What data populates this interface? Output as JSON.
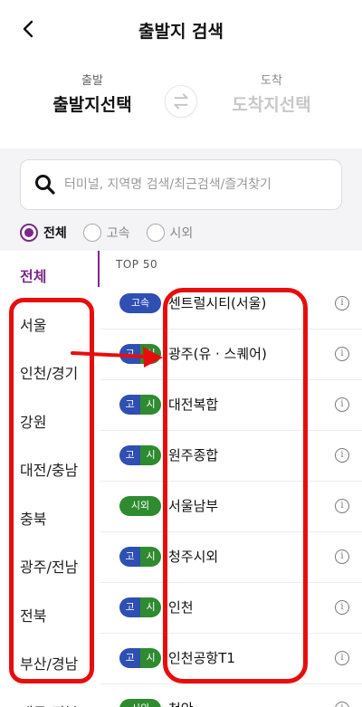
{
  "header": {
    "title": "출발지 검색"
  },
  "route": {
    "departure_label": "출발",
    "departure_value": "출발지선택",
    "arrival_label": "도착",
    "arrival_value": "도착지선택"
  },
  "search": {
    "placeholder": "터미널, 지역명 검색/최근검색/즐겨찾기"
  },
  "filters": [
    {
      "label": "전체",
      "selected": true
    },
    {
      "label": "고속",
      "selected": false
    },
    {
      "label": "시외",
      "selected": false
    }
  ],
  "regions": [
    "전체",
    "서울",
    "인천/경기",
    "강원",
    "대전/충남",
    "충북",
    "광주/전남",
    "전북",
    "부산/경남",
    "대구/경북"
  ],
  "list": {
    "heading": "TOP 50",
    "rows": [
      {
        "badge": "고속",
        "badge_type": "express",
        "name": "센트럴시티(서울)"
      },
      {
        "badge_a": "고",
        "badge_b": "시",
        "badge_type": "both",
        "name": "광주(유 · 스퀘어)"
      },
      {
        "badge_a": "고",
        "badge_b": "시",
        "badge_type": "both",
        "name": "대전복합"
      },
      {
        "badge_a": "고",
        "badge_b": "시",
        "badge_type": "both",
        "name": "원주종합"
      },
      {
        "badge": "시외",
        "badge_type": "intercity",
        "name": "서울남부"
      },
      {
        "badge_a": "고",
        "badge_b": "시",
        "badge_type": "both",
        "name": "청주시외"
      },
      {
        "badge_a": "고",
        "badge_b": "시",
        "badge_type": "both",
        "name": "인천"
      },
      {
        "badge_a": "고",
        "badge_b": "시",
        "badge_type": "both",
        "name": "인천공항T1"
      },
      {
        "badge": "시외",
        "badge_type": "intercity",
        "name": "천안"
      }
    ]
  },
  "colors": {
    "accent": "#7b2b86",
    "express": "#2f4fb3",
    "intercity": "#2e8b2f",
    "annotation": "#e80d0d"
  }
}
